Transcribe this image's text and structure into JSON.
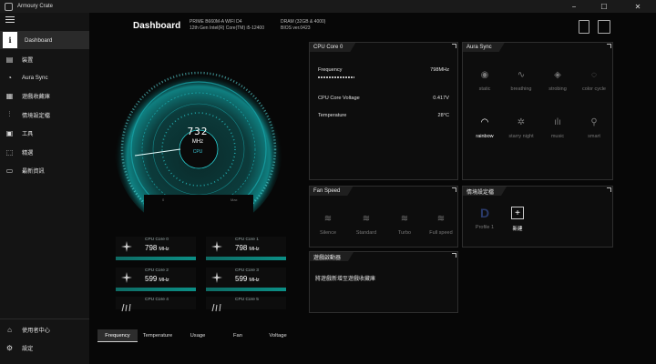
{
  "window": {
    "title": "Armoury Crate",
    "minimize": "−",
    "maximize": "☐",
    "close": "✕"
  },
  "sidebar": {
    "items": [
      {
        "label": "Dashboard",
        "icon": "info-icon",
        "glyph": "i"
      },
      {
        "label": "裝置",
        "icon": "keyboard-icon",
        "glyph": "▤"
      },
      {
        "label": "Aura Sync",
        "icon": "aura-icon",
        "glyph": "◔"
      },
      {
        "label": "遊戲收藏庫",
        "icon": "library-icon",
        "glyph": "▦"
      },
      {
        "label": "情境設定檔",
        "icon": "sliders-icon",
        "glyph": "⫶"
      },
      {
        "label": "工具",
        "icon": "toolbox-icon",
        "glyph": "▣"
      },
      {
        "label": "精選",
        "icon": "tag-icon",
        "glyph": "⬚"
      },
      {
        "label": "最新資訊",
        "icon": "news-icon",
        "glyph": "▭"
      }
    ],
    "bottom": [
      {
        "label": "使用者中心",
        "icon": "user-center-icon",
        "glyph": "⌂"
      },
      {
        "label": "設定",
        "icon": "settings-icon",
        "glyph": "⚙"
      }
    ]
  },
  "header": {
    "title": "Dashboard",
    "info_col1": [
      "PRIME B660M-A WIFI D4",
      "12th Gen Intel(R) Core(TM) i5-12400"
    ],
    "info_col2": [
      "DRAM (32GB & 4000)",
      "BIOS ver.0423"
    ],
    "top_icons": [
      "profile-r-icon",
      "layout-icon"
    ]
  },
  "gauge": {
    "value": "732",
    "unit": "MHz",
    "label": "CPU",
    "min_label": "0",
    "max_label": "Max"
  },
  "cores": [
    {
      "label": "CPU Core 0",
      "value": "798",
      "unit": "MHz",
      "highlight": true
    },
    {
      "label": "CPU Core 1",
      "value": "798",
      "unit": "MHz",
      "highlight": true
    },
    {
      "label": "CPU Core 2",
      "value": "599",
      "unit": "MHz",
      "highlight": true
    },
    {
      "label": "CPU Core 3",
      "value": "599",
      "unit": "MHz",
      "highlight": true
    },
    {
      "label": "CPU Core 4",
      "value": "",
      "unit": "",
      "highlight": false
    },
    {
      "label": "CPU Core 5",
      "value": "",
      "unit": "",
      "highlight": false
    }
  ],
  "bottom_tabs": [
    {
      "label": "Frequency",
      "active": true
    },
    {
      "label": "Temperature",
      "active": false
    },
    {
      "label": "Usage",
      "active": false
    },
    {
      "label": "Fan",
      "active": false
    },
    {
      "label": "Voltage",
      "active": false
    }
  ],
  "cpu_panel": {
    "title": "CPU Core 0",
    "rows": [
      {
        "label": "Frequency",
        "value": "798MHz"
      },
      {
        "label": "CPU Core Voltage",
        "value": "0.417V"
      },
      {
        "label": "Temperature",
        "value": "28°C"
      }
    ]
  },
  "aura_panel": {
    "title": "Aura Sync",
    "effects": [
      {
        "label": "static",
        "icon": "static-icon",
        "glyph": "◉",
        "active": false
      },
      {
        "label": "breathing",
        "icon": "breathing-icon",
        "glyph": "∿",
        "active": false
      },
      {
        "label": "strobing",
        "icon": "strobing-icon",
        "glyph": "◈",
        "active": false
      },
      {
        "label": "color cycle",
        "icon": "color-cycle-icon",
        "glyph": "◌",
        "active": false
      },
      {
        "label": "rainbow",
        "icon": "rainbow-icon",
        "glyph": "◠",
        "active": true
      },
      {
        "label": "starry night",
        "icon": "starry-night-icon",
        "glyph": "✲",
        "active": false
      },
      {
        "label": "music",
        "icon": "music-icon",
        "glyph": "ılı",
        "active": false
      },
      {
        "label": "smart",
        "icon": "smart-icon",
        "glyph": "⚲",
        "active": false
      }
    ]
  },
  "fan_panel": {
    "title": "Fan Speed",
    "modes": [
      {
        "label": "Silence",
        "icon": "fan-silence-icon",
        "glyph": "≋"
      },
      {
        "label": "Standard",
        "icon": "fan-standard-icon",
        "glyph": "≋"
      },
      {
        "label": "Turbo",
        "icon": "fan-turbo-icon",
        "glyph": "≋"
      },
      {
        "label": "Full speed",
        "icon": "fan-full-icon",
        "glyph": "≋"
      }
    ]
  },
  "profile_panel": {
    "title": "情境設定檔",
    "profiles": [
      {
        "label": "Profile 1",
        "icon": "profile-icon",
        "glyph": "D",
        "active": false
      },
      {
        "label": "新建",
        "icon": "add-profile-icon",
        "glyph": "+",
        "active": true
      }
    ]
  },
  "game_panel": {
    "title": "遊戲啟動器",
    "message": "將遊戲新增至遊戲收藏庫"
  },
  "colors": {
    "accent": "#1ec8c8",
    "bg": "#070707",
    "panel": "#0d0d0d"
  }
}
